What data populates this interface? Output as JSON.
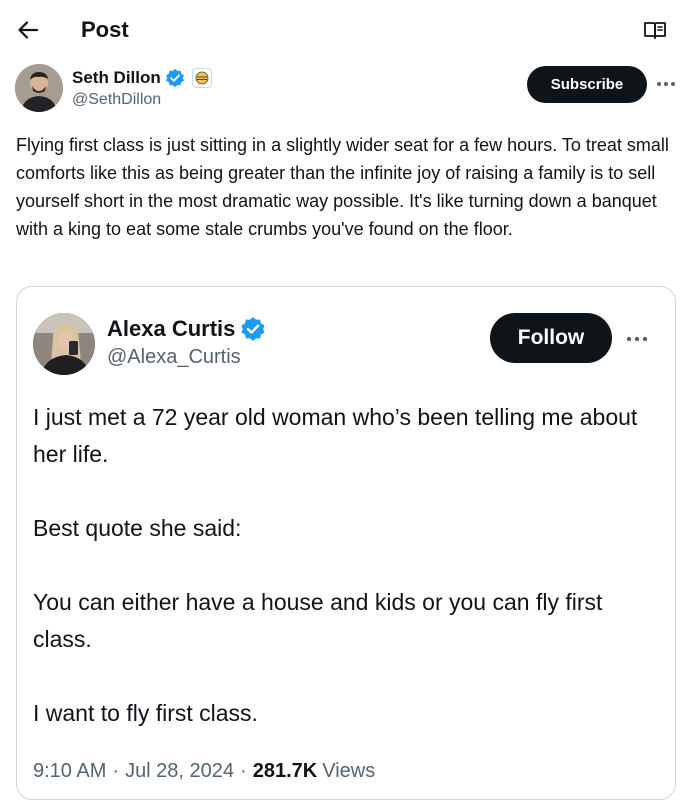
{
  "header": {
    "title": "Post",
    "back_icon": "arrow-left-icon",
    "reader_icon": "reader-mode-icon"
  },
  "author": {
    "name": "Seth Dillon",
    "handle": "@SethDillon",
    "verified": true,
    "verified_color": "#1d9bf0",
    "affiliate_icon": "affiliate-badge-icon",
    "subscribe_label": "Subscribe"
  },
  "post": {
    "text": "Flying first class is just sitting in a slightly wider seat for a few hours. To treat small comforts like this as being greater than the infinite joy of raising a family is to sell yourself short in the most dramatic way possible. It's like turning down a banquet with a king to eat some stale crumbs you've found on the floor."
  },
  "quoted": {
    "name": "Alexa Curtis",
    "handle": "@Alexa_Curtis",
    "verified": true,
    "follow_label": "Follow",
    "paragraphs": [
      "I just met a 72 year old woman who’s been telling me about her life.",
      "Best quote she said:",
      "You can either have a house and kids or you can fly first class.",
      "I want to fly first class."
    ],
    "time": "9:10 AM",
    "date": "Jul 28, 2024",
    "views_count": "281.7K",
    "views_label": "Views"
  },
  "colors": {
    "text": "#0f1419",
    "secondary": "#536471",
    "button": "#0f1419",
    "border": "#cfd9de",
    "verified": "#1d9bf0"
  }
}
